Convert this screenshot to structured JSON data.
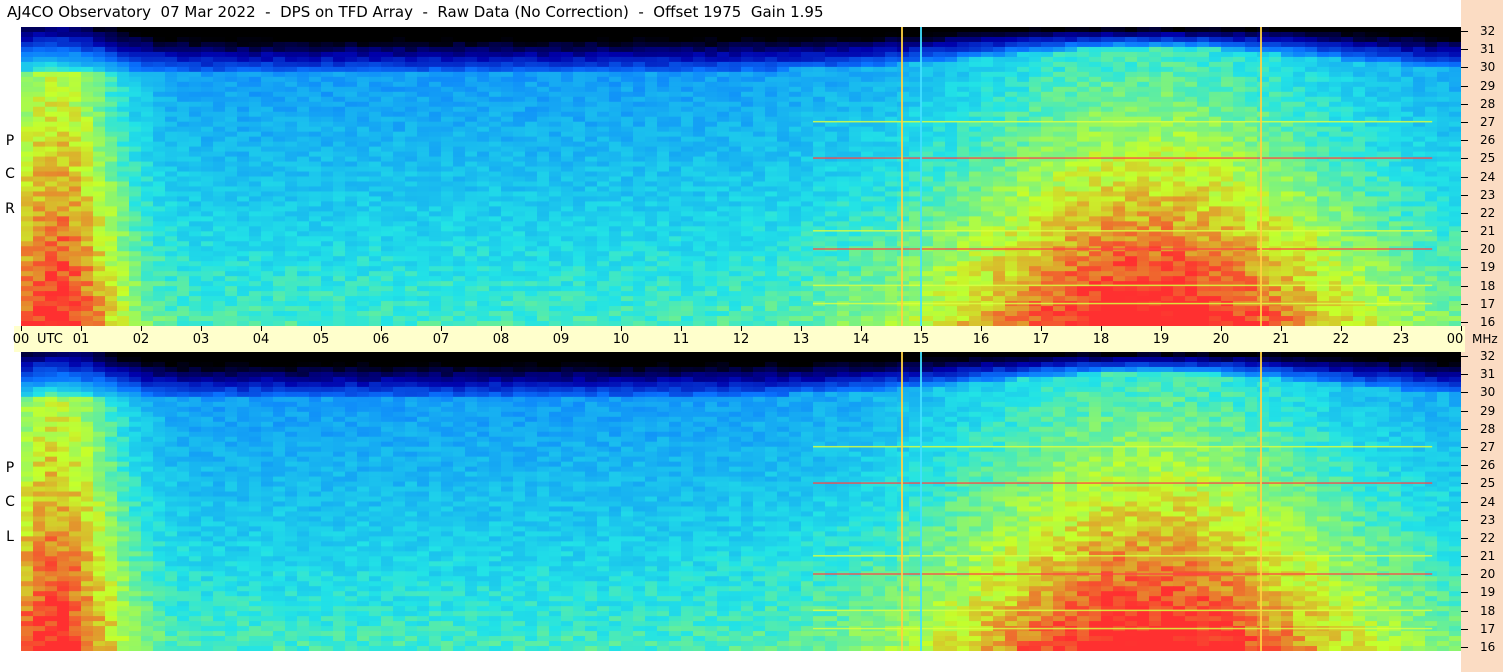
{
  "title": "AJ4CO Observatory  07 Mar 2022  -  DPS on TFD Array  -  Raw Data (No Correction)  -  Offset 1975  Gain 1.95",
  "panels": [
    {
      "id": "top",
      "label_letters": [
        "P",
        "C",
        "R"
      ]
    },
    {
      "id": "bottom",
      "label_letters": [
        "P",
        "C",
        "L"
      ]
    }
  ],
  "time_axis": {
    "utc_label": "UTC",
    "ticks": [
      "00",
      "01",
      "02",
      "03",
      "04",
      "05",
      "06",
      "07",
      "08",
      "09",
      "10",
      "11",
      "12",
      "13",
      "14",
      "15",
      "16",
      "17",
      "18",
      "19",
      "20",
      "21",
      "22",
      "23",
      "00"
    ]
  },
  "freq_axis": {
    "unit": "MHz",
    "ticks": [
      "32",
      "31",
      "30",
      "29",
      "28",
      "27",
      "26",
      "25",
      "24",
      "23",
      "22",
      "21",
      "20",
      "19",
      "18",
      "17",
      "16"
    ]
  },
  "chart_data": {
    "type": "heatmap",
    "title": "AJ4CO Observatory  07 Mar 2022  -  DPS on TFD Array  -  Raw Data (No Correction)  -  Offset 1975  Gain 1.95",
    "x": {
      "label": "UTC",
      "range": [
        "00",
        "00"
      ],
      "unit": "hours"
    },
    "y": {
      "label": "MHz",
      "range": [
        16,
        32
      ]
    },
    "series": [
      {
        "name": "RCP",
        "description_level": "spectrogram intensity"
      },
      {
        "name": "LCP",
        "description_level": "spectrogram intensity"
      }
    ],
    "colors": {
      "background_low": "#000000",
      "low": "#0000aa",
      "mid": "#0a74ff",
      "high": "#22e3e6",
      "higher": "#c6ff2a",
      "peak": "#ff3030"
    },
    "vertical_lines_utc": [
      "14:40",
      "14:59",
      "20:39"
    ],
    "horizontal_bright_lines_mhz": [
      17,
      18,
      20,
      21,
      25,
      27
    ]
  },
  "colors": {
    "time_bar": "#ffffcc",
    "freq_strip": "#fbdcc3"
  }
}
